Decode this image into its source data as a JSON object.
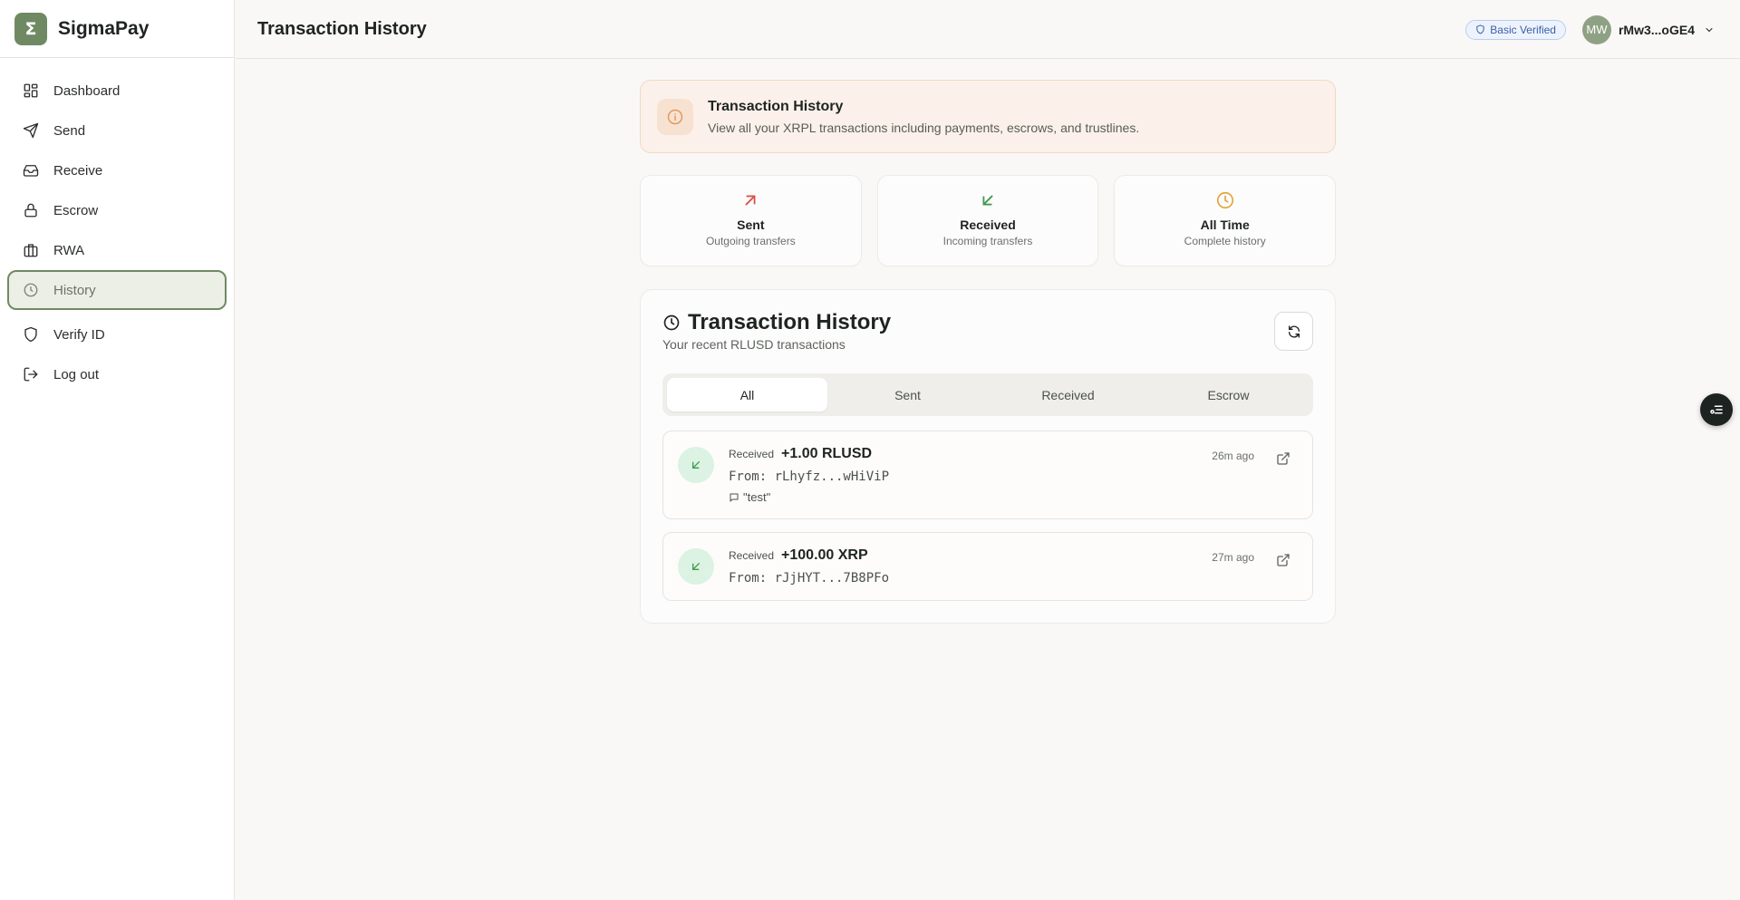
{
  "brand": {
    "logo_glyph": "Σ",
    "name": "SigmaPay",
    "accent": "#6f8a63"
  },
  "sidebar": {
    "items": [
      {
        "label": "Dashboard",
        "icon": "dashboard-icon"
      },
      {
        "label": "Send",
        "icon": "send-icon"
      },
      {
        "label": "Receive",
        "icon": "inbox-icon"
      },
      {
        "label": "Escrow",
        "icon": "lock-icon"
      },
      {
        "label": "RWA",
        "icon": "briefcase-icon"
      },
      {
        "label": "History",
        "icon": "clock-icon",
        "active": true
      },
      {
        "label": "Verify ID",
        "icon": "shield-icon"
      },
      {
        "label": "Log out",
        "icon": "logout-icon"
      }
    ]
  },
  "header": {
    "title": "Transaction History",
    "badge": "Basic Verified",
    "avatar_initials": "MW",
    "address": "rMw3...oGE4"
  },
  "info": {
    "title": "Transaction History",
    "description": "View all your XRPL transactions including payments, escrows, and trustlines."
  },
  "stats": [
    {
      "label": "Sent",
      "sub": "Outgoing transfers",
      "icon": "arrow-up-right-icon",
      "color": "#d9534a"
    },
    {
      "label": "Received",
      "sub": "Incoming transfers",
      "icon": "arrow-down-left-icon",
      "color": "#3f9a4e"
    },
    {
      "label": "All Time",
      "sub": "Complete history",
      "icon": "clock-icon",
      "color": "#e0a53a"
    }
  ],
  "history": {
    "title": "Transaction History",
    "subtitle": "Your recent RLUSD transactions",
    "tabs": [
      "All",
      "Sent",
      "Received",
      "Escrow"
    ],
    "active_tab": "All",
    "transactions": [
      {
        "type": "Received",
        "amount": "+1.00 RLUSD",
        "from": "From: rLhyfz...wHiViP",
        "memo": "\"test\"",
        "time": "26m ago"
      },
      {
        "type": "Received",
        "amount": "+100.00 XRP",
        "from": "From: rJjHYT...7B8PFo",
        "time": "27m ago"
      }
    ]
  }
}
